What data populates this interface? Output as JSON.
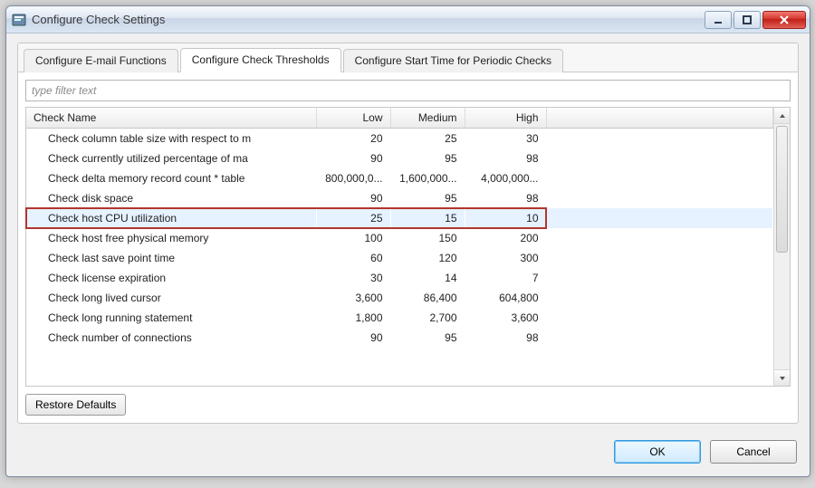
{
  "window": {
    "title": "Configure Check Settings"
  },
  "tabs": [
    {
      "label": "Configure E-mail Functions",
      "active": false
    },
    {
      "label": "Configure Check Thresholds",
      "active": true
    },
    {
      "label": "Configure Start Time for Periodic Checks",
      "active": false
    }
  ],
  "filter": {
    "placeholder": "type filter text",
    "value": ""
  },
  "table": {
    "columns": {
      "name": "Check Name",
      "low": "Low",
      "medium": "Medium",
      "high": "High"
    },
    "rows": [
      {
        "name": "Check column table size with respect to m",
        "low": "20",
        "medium": "25",
        "high": "30",
        "selected": false
      },
      {
        "name": "Check currently utilized percentage of ma",
        "low": "90",
        "medium": "95",
        "high": "98",
        "selected": false
      },
      {
        "name": "Check delta memory record count * table",
        "low": "800,000,0...",
        "medium": "1,600,000...",
        "high": "4,000,000...",
        "selected": false
      },
      {
        "name": "Check disk space",
        "low": "90",
        "medium": "95",
        "high": "98",
        "selected": false
      },
      {
        "name": "Check host CPU utilization",
        "low": "25",
        "medium": "15",
        "high": "10",
        "selected": true
      },
      {
        "name": "Check host free physical memory",
        "low": "100",
        "medium": "150",
        "high": "200",
        "selected": false
      },
      {
        "name": "Check last save point time",
        "low": "60",
        "medium": "120",
        "high": "300",
        "selected": false
      },
      {
        "name": "Check license expiration",
        "low": "30",
        "medium": "14",
        "high": "7",
        "selected": false
      },
      {
        "name": "Check long lived cursor",
        "low": "3,600",
        "medium": "86,400",
        "high": "604,800",
        "selected": false
      },
      {
        "name": "Check long running statement",
        "low": "1,800",
        "medium": "2,700",
        "high": "3,600",
        "selected": false
      },
      {
        "name": "Check number of connections",
        "low": "90",
        "medium": "95",
        "high": "98",
        "selected": false
      }
    ]
  },
  "buttons": {
    "restore_defaults": "Restore Defaults",
    "ok": "OK",
    "cancel": "Cancel"
  }
}
